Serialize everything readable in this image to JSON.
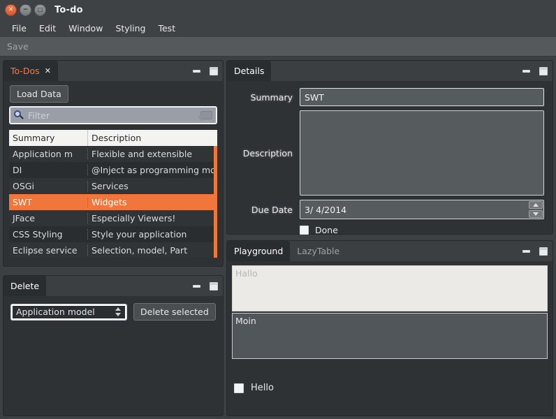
{
  "window": {
    "title": "To-do",
    "buttons": [
      {
        "name": "close",
        "glyph": "✕"
      },
      {
        "name": "minimize",
        "glyph": "−"
      },
      {
        "name": "maximize",
        "glyph": "□"
      }
    ]
  },
  "menubar": {
    "items": [
      "File",
      "Edit",
      "Window",
      "Styling",
      "Test"
    ]
  },
  "toolbar": {
    "save_label": "Save"
  },
  "colors": {
    "accent": "#f0763c",
    "window_bg": "#3c4042",
    "part_bg": "#2f3235",
    "tab_active_bg": "#2a2d30",
    "field_bg": "#565b5e",
    "selection": "#f0763c"
  },
  "todos_part": {
    "tabs": [
      {
        "label": "To-Dos",
        "active": true,
        "closable": true,
        "close_glyph": "✕"
      }
    ],
    "controls": {
      "minimize": "minimize-icon",
      "maximize": "maximize-icon"
    },
    "load_button": "Load Data",
    "filter": {
      "placeholder": "Filter",
      "value": "",
      "icon": "search-icon",
      "clear_icon": "clear-icon"
    },
    "table": {
      "columns": [
        "Summary",
        "Description"
      ],
      "rows": [
        {
          "summary": "Application m",
          "description": "Flexible and extensible",
          "selected": false
        },
        {
          "summary": "DI",
          "description": "@Inject as programming mo",
          "selected": false
        },
        {
          "summary": "OSGi",
          "description": "Services",
          "selected": false
        },
        {
          "summary": "SWT",
          "description": "Widgets",
          "selected": true
        },
        {
          "summary": "JFace",
          "description": "Especially Viewers!",
          "selected": false
        },
        {
          "summary": "CSS Styling",
          "description": "Style your application",
          "selected": false
        },
        {
          "summary": "Eclipse service",
          "description": "Selection, model, Part",
          "selected": false
        }
      ]
    }
  },
  "delete_part": {
    "tabs": [
      {
        "label": "Delete",
        "active": true,
        "closable": false
      }
    ],
    "controls": {
      "minimize": "minimize-icon",
      "maximize": "maximize-icon"
    },
    "combo_value": "Application model",
    "delete_button": "Delete selected"
  },
  "details_part": {
    "tabs": [
      {
        "label": "Details",
        "active": true,
        "closable": false
      }
    ],
    "controls": {
      "minimize": "minimize-icon",
      "maximize": "maximize-icon"
    },
    "fields": {
      "summary_label": "Summary",
      "summary_value": "SWT",
      "description_label": "Description",
      "description_value": "",
      "duedate_label": "Due Date",
      "duedate_value": "3/ 4/2014",
      "done_label": "Done",
      "done_checked": false
    }
  },
  "playground_part": {
    "tabs": [
      {
        "label": "Playground",
        "active": true
      },
      {
        "label": "LazyTable",
        "active": false
      }
    ],
    "controls": {
      "minimize": "minimize-icon",
      "maximize": "maximize-icon"
    },
    "text_light": "Hallo",
    "text_dark": "Moin",
    "checkbox_label": "Hello",
    "checkbox_checked": false
  }
}
